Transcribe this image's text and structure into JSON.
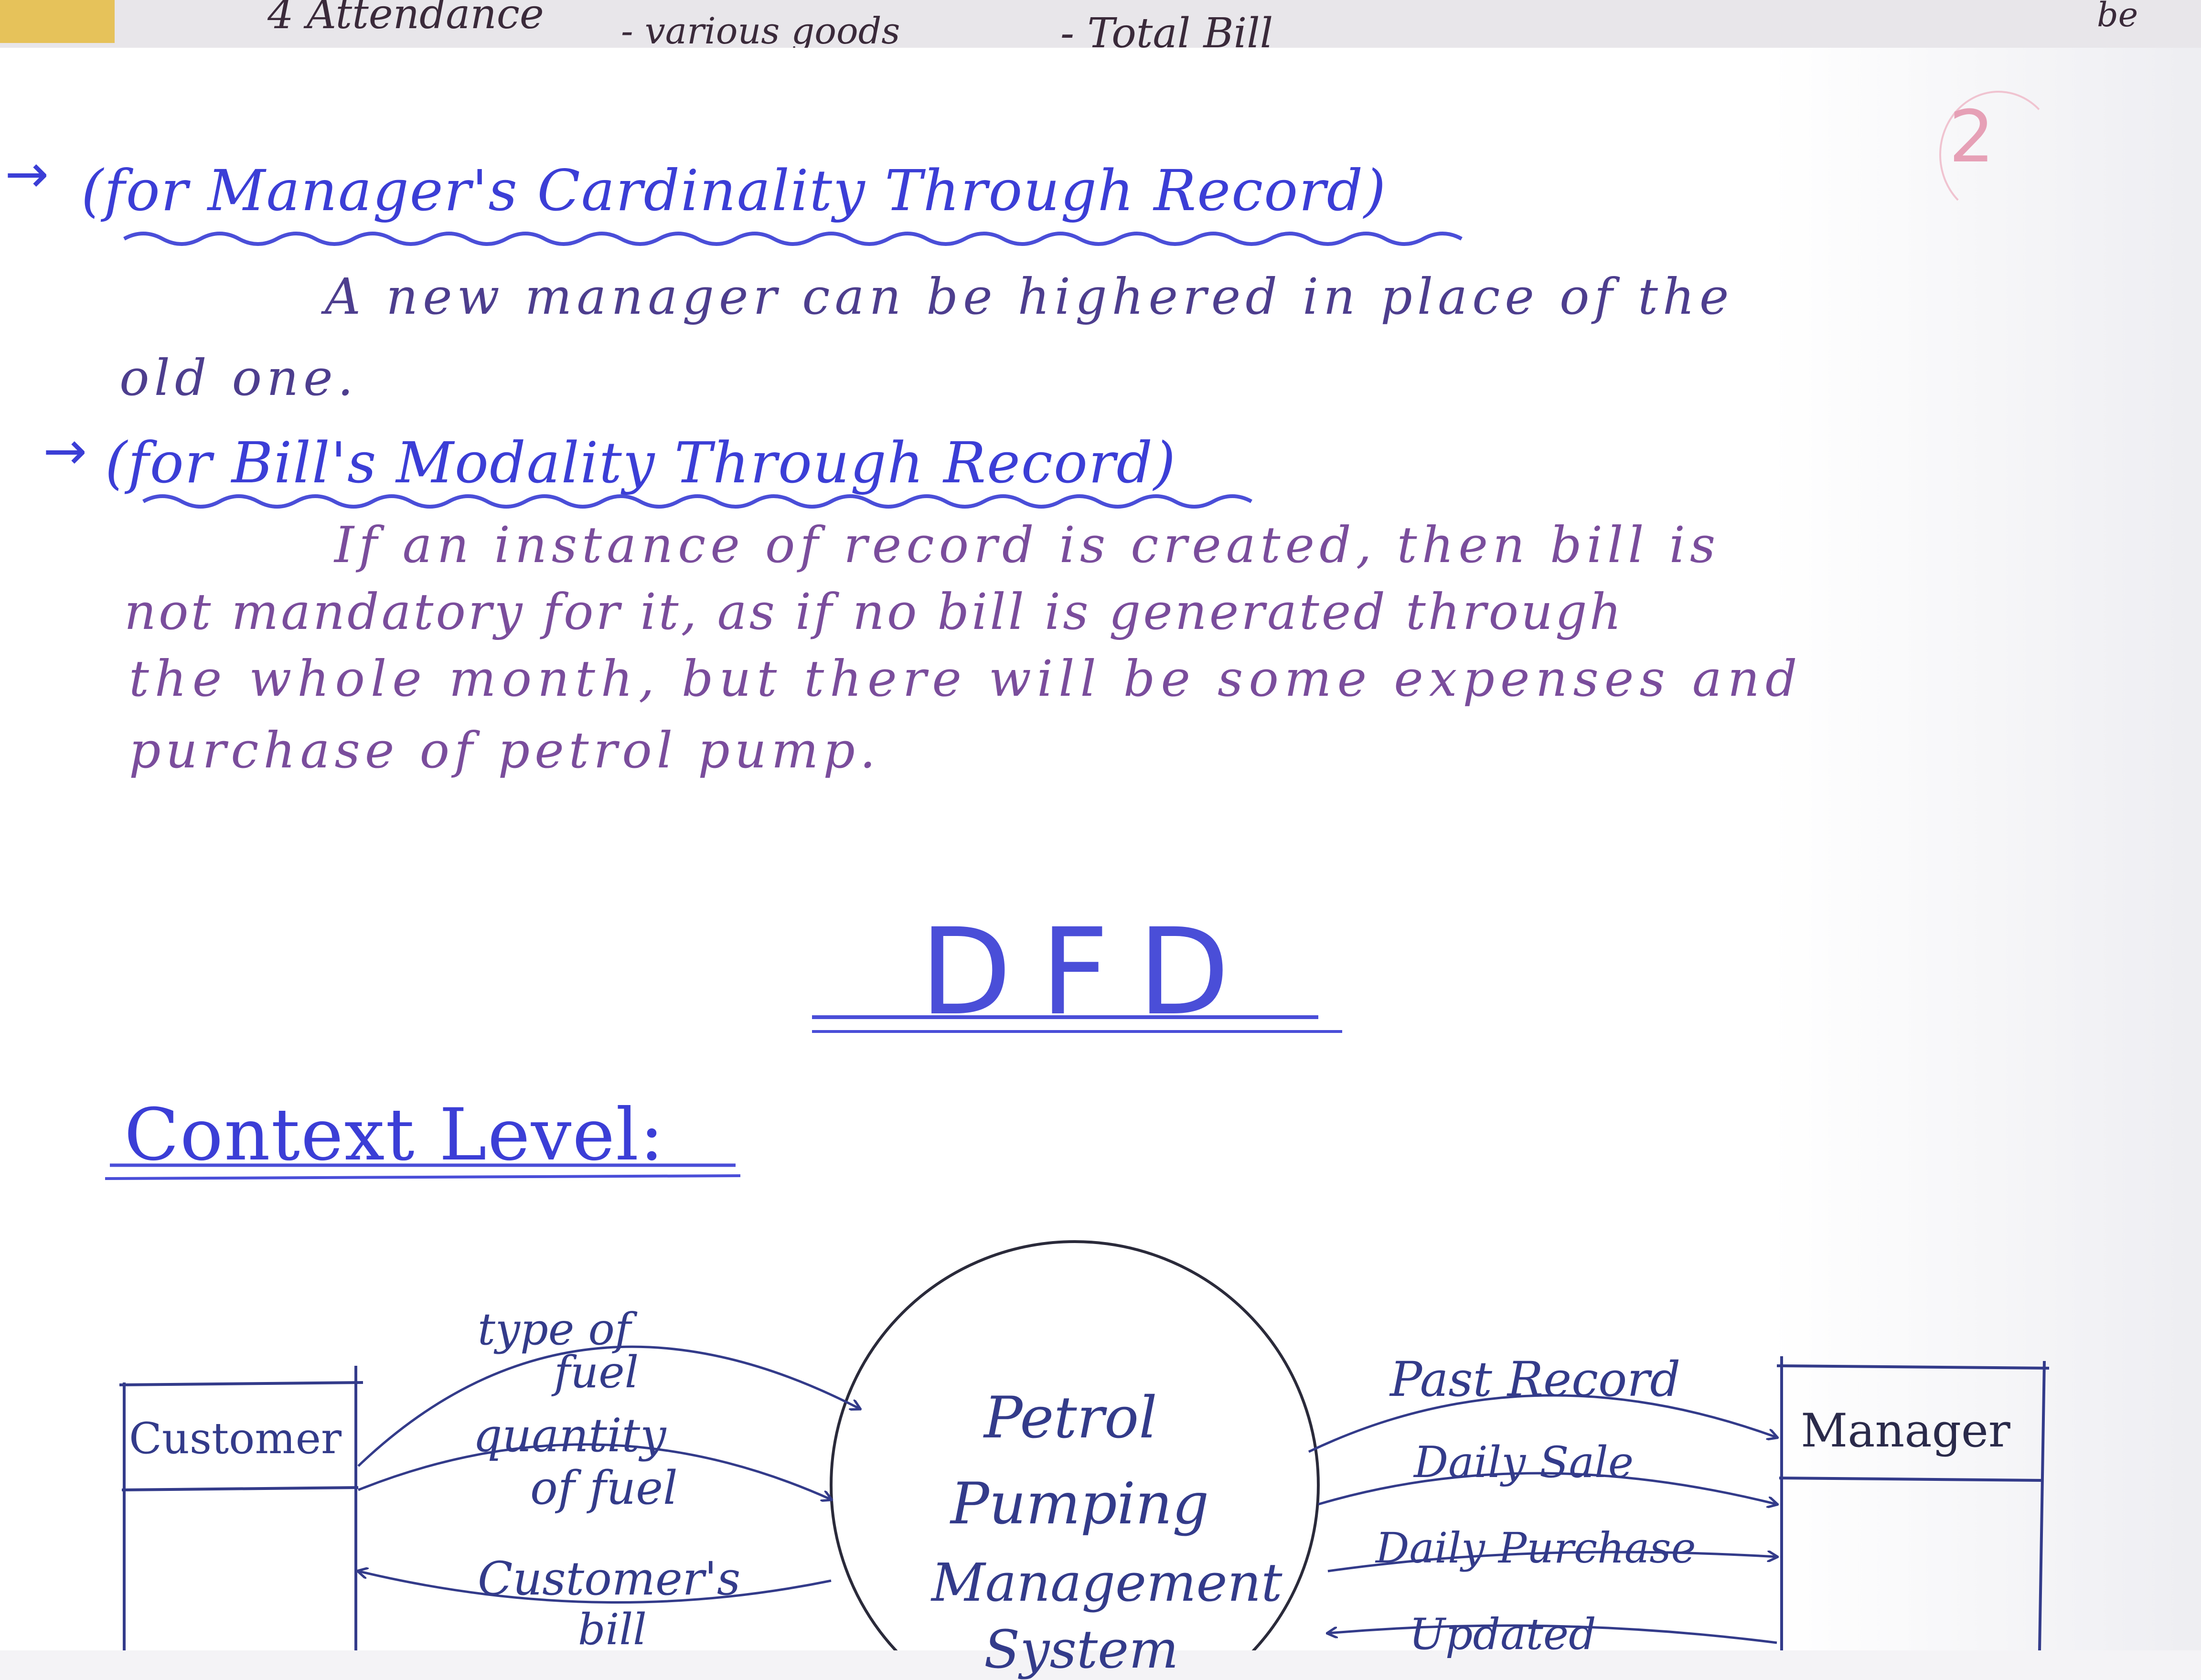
{
  "top_strip": {
    "line1": "4 Attendance",
    "line2": "- various goods",
    "line3": "- Total Bill",
    "corner": "be"
  },
  "page_number": "2",
  "section1": {
    "heading": "(for Manager's Cardinality Through Record)",
    "line1": "A new manager can be highered in place of the",
    "line2": "old one."
  },
  "section2": {
    "heading": "(for Bill's Modality Through Record)",
    "line1": "If an instance of record is created, then bill is",
    "line2": "not mandatory for it, as if no bill is generated through",
    "line3": "the whole month, but there will be some expenses and",
    "line4": "purchase of petrol pump."
  },
  "dfd_title": "DFD",
  "context_heading": "Context Level:",
  "diagram": {
    "left_entity": "Customer",
    "right_entity": "Manager",
    "process_line1": "Petrol",
    "process_line2": "Pumping",
    "process_line3": "Management",
    "process_line4": "System",
    "flow_type_a": "type of",
    "flow_type_b": "fuel",
    "flow_qty_a": "quantity",
    "flow_qty_b": "of fuel",
    "flow_bill_a": "Customer's",
    "flow_bill_b": "bill",
    "flow_past": "Past Record",
    "flow_sale": "Daily Sale",
    "flow_purchase": "Daily Purchase",
    "flow_update": "Updated"
  },
  "colors": {
    "heading_ink": "#3b3ed6",
    "text_ink": "#4d3e8e",
    "diagram_ink": "#333b8a"
  }
}
